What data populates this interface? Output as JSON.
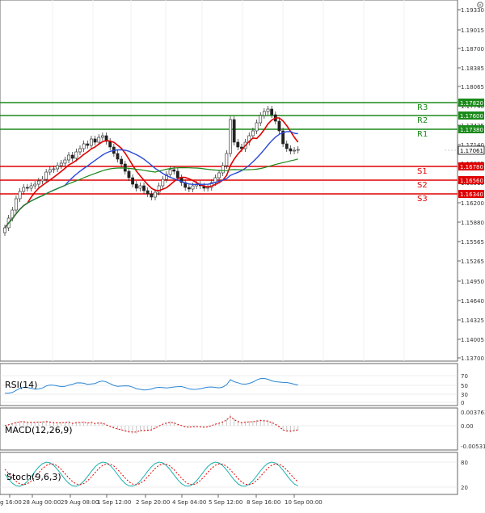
{
  "window": {
    "gear_icon": "gear-icon"
  },
  "main": {
    "y_ticks": [
      "1.19330",
      "1.19015",
      "1.18700",
      "1.18385",
      "1.18065",
      "1.17740",
      "1.17425",
      "1.17140",
      "1.16835",
      "1.16515",
      "1.16200",
      "1.15880",
      "1.15565",
      "1.15265",
      "1.14950",
      "1.14640",
      "1.14325",
      "1.14005",
      "1.13700"
    ],
    "levels": [
      {
        "name": "R3",
        "value": "1.17820",
        "color": "#1a8a1a"
      },
      {
        "name": "R2",
        "value": "1.17600",
        "color": "#1a8a1a"
      },
      {
        "name": "R1",
        "value": "1.17380",
        "color": "#1a8a1a"
      },
      {
        "name": "S1",
        "value": "1.16780",
        "color": "#e00000"
      },
      {
        "name": "S2",
        "value": "1.16560",
        "color": "#e00000"
      },
      {
        "name": "S3",
        "value": "1.16340",
        "color": "#e00000"
      }
    ],
    "current_price": "1.17061"
  },
  "rsi": {
    "label": "RSI(14)",
    "ticks": [
      "70",
      "50",
      "30",
      "0"
    ]
  },
  "macd": {
    "label": "MACD(12,26,9)",
    "ticks": [
      "0.003763",
      "0.00",
      "-0.005312"
    ]
  },
  "stoch": {
    "label": "Stoch(9,6,3)",
    "ticks": [
      "80",
      "20"
    ]
  },
  "x_labels": [
    "g 16:00",
    "28 Aug 00:00",
    "29 Aug 08:00",
    "1 Sep 12:00",
    "2 Sep 20:00",
    "4 Sep 04:00",
    "5 Sep 12:00",
    "8 Sep 16:00",
    "10 Sep 00:00"
  ],
  "colors": {
    "bull": "#1a8a1a",
    "bear": "#e00000",
    "ma_fast": "#e00000",
    "ma_mid": "#2a4adb",
    "ma_slow": "#1a8a1a",
    "rsi": "#2a86d6",
    "stoch_k": "#19b0b0",
    "stoch_d": "#e00000"
  }
}
